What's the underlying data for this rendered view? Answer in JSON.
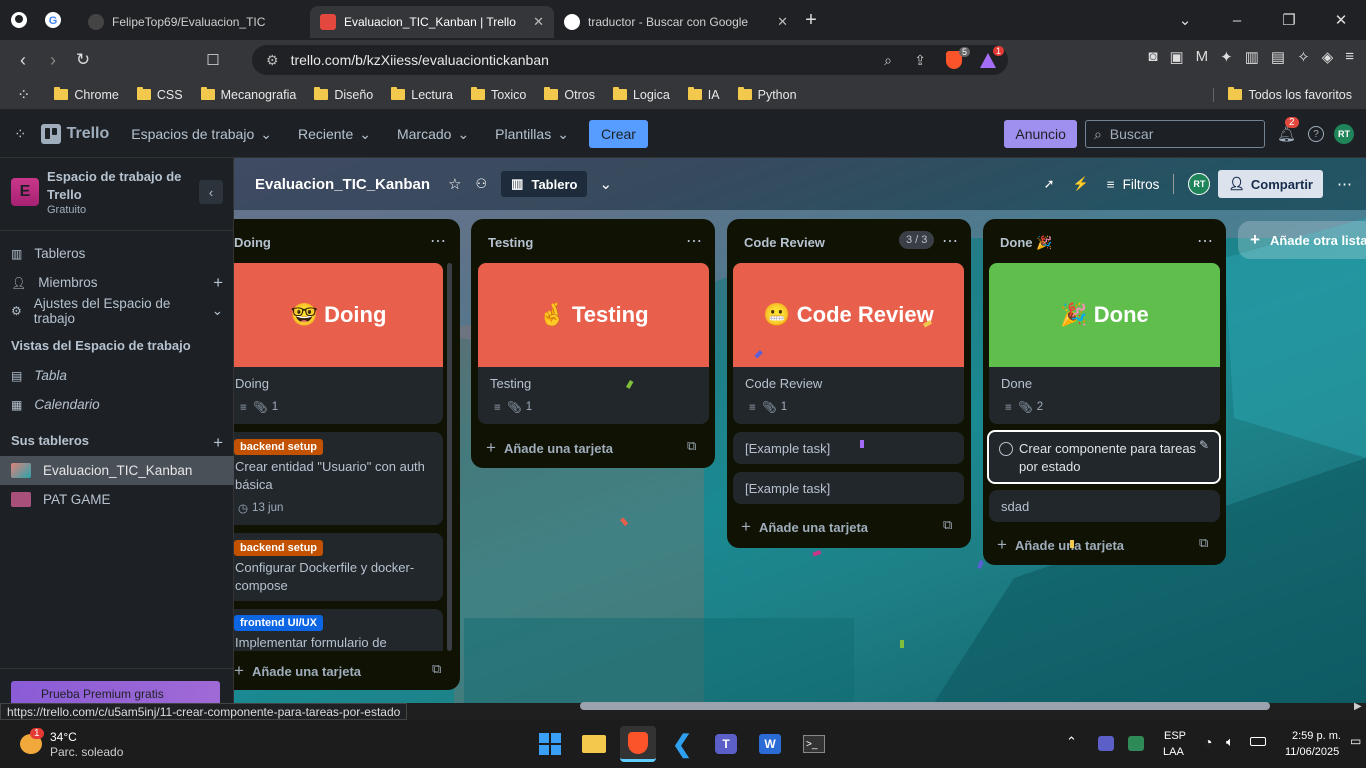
{
  "browser": {
    "tabs": [
      {
        "title": "FelipeTop69/Evaluacion_TIC",
        "active": false
      },
      {
        "title": "Evaluacion_TIC_Kanban | Trello",
        "active": true
      },
      {
        "title": "traductor - Buscar con Google",
        "active": false
      }
    ],
    "url": "trello.com/b/kzXiiess/evaluaciontickanban",
    "shield_badge": "5",
    "alert_badge": "1",
    "bookmarks": [
      "Chrome",
      "CSS",
      "Mecanografia",
      "Diseño",
      "Lectura",
      "Toxico",
      "Otros",
      "Logica",
      "IA",
      "Python"
    ],
    "all_bookmarks": "Todos los favoritos"
  },
  "trello": {
    "logo": "Trello",
    "menus": [
      "Espacios de trabajo",
      "Reciente",
      "Marcado",
      "Plantillas"
    ],
    "create": "Crear",
    "announce": "Anuncio",
    "search_placeholder": "Buscar",
    "notif_count": "2",
    "avatar": "RT"
  },
  "sidebar": {
    "workspace_name": "Espacio de trabajo de Trello",
    "workspace_plan": "Gratuito",
    "workspace_initial": "E",
    "items": [
      "Tableros",
      "Miembros",
      "Ajustes del Espacio de trabajo"
    ],
    "views_title": "Vistas del Espacio de trabajo",
    "views": [
      "Tabla",
      "Calendario"
    ],
    "boards_title": "Sus tableros",
    "boards": [
      "Evaluacion_TIC_Kanban",
      "PAT GAME"
    ],
    "premium": "Prueba Premium gratis"
  },
  "board": {
    "title": "Evaluacion_TIC_Kanban",
    "view": "Tablero",
    "filters": "Filtros",
    "share": "Compartir",
    "add_list": "Añade otra lista",
    "add_card": "Añade una tarjeta",
    "lists": {
      "doing": {
        "title": "Doing",
        "cover": "🤓 Doing",
        "cover_card": "Doing",
        "attach": "1",
        "cards": [
          {
            "label": "backend setup",
            "text": "Crear entidad \"Usuario\" con auth básica",
            "date": "13 jun"
          },
          {
            "label": "backend setup",
            "text": "Configurar Dockerfile y docker-compose"
          },
          {
            "label": "frontend UI/UX",
            "text": "Implementar formulario de"
          }
        ]
      },
      "testing": {
        "title": "Testing",
        "cover": "🤞 Testing",
        "cover_card": "Testing",
        "attach": "1"
      },
      "review": {
        "title": "Code Review",
        "count": "3 / 3",
        "cover": "😬 Code Review",
        "cover_card": "Code Review",
        "attach": "1",
        "cards": [
          "[Example task]",
          "[Example task]"
        ]
      },
      "done": {
        "title": "Done 🎉",
        "cover": "🎉 Done",
        "cover_card": "Done",
        "attach": "2",
        "cards": [
          "Crear componente para tareas por estado",
          "sdad"
        ]
      }
    }
  },
  "status_url": "https://trello.com/c/u5am5inj/11-crear-componente-para-tareas-por-estado",
  "taskbar": {
    "temp": "34°C",
    "weather": "Parc. soleado",
    "weather_badge": "1",
    "lang1": "ESP",
    "lang2": "LAA",
    "time": "2:59 p. m.",
    "date": "11/06/2025"
  }
}
